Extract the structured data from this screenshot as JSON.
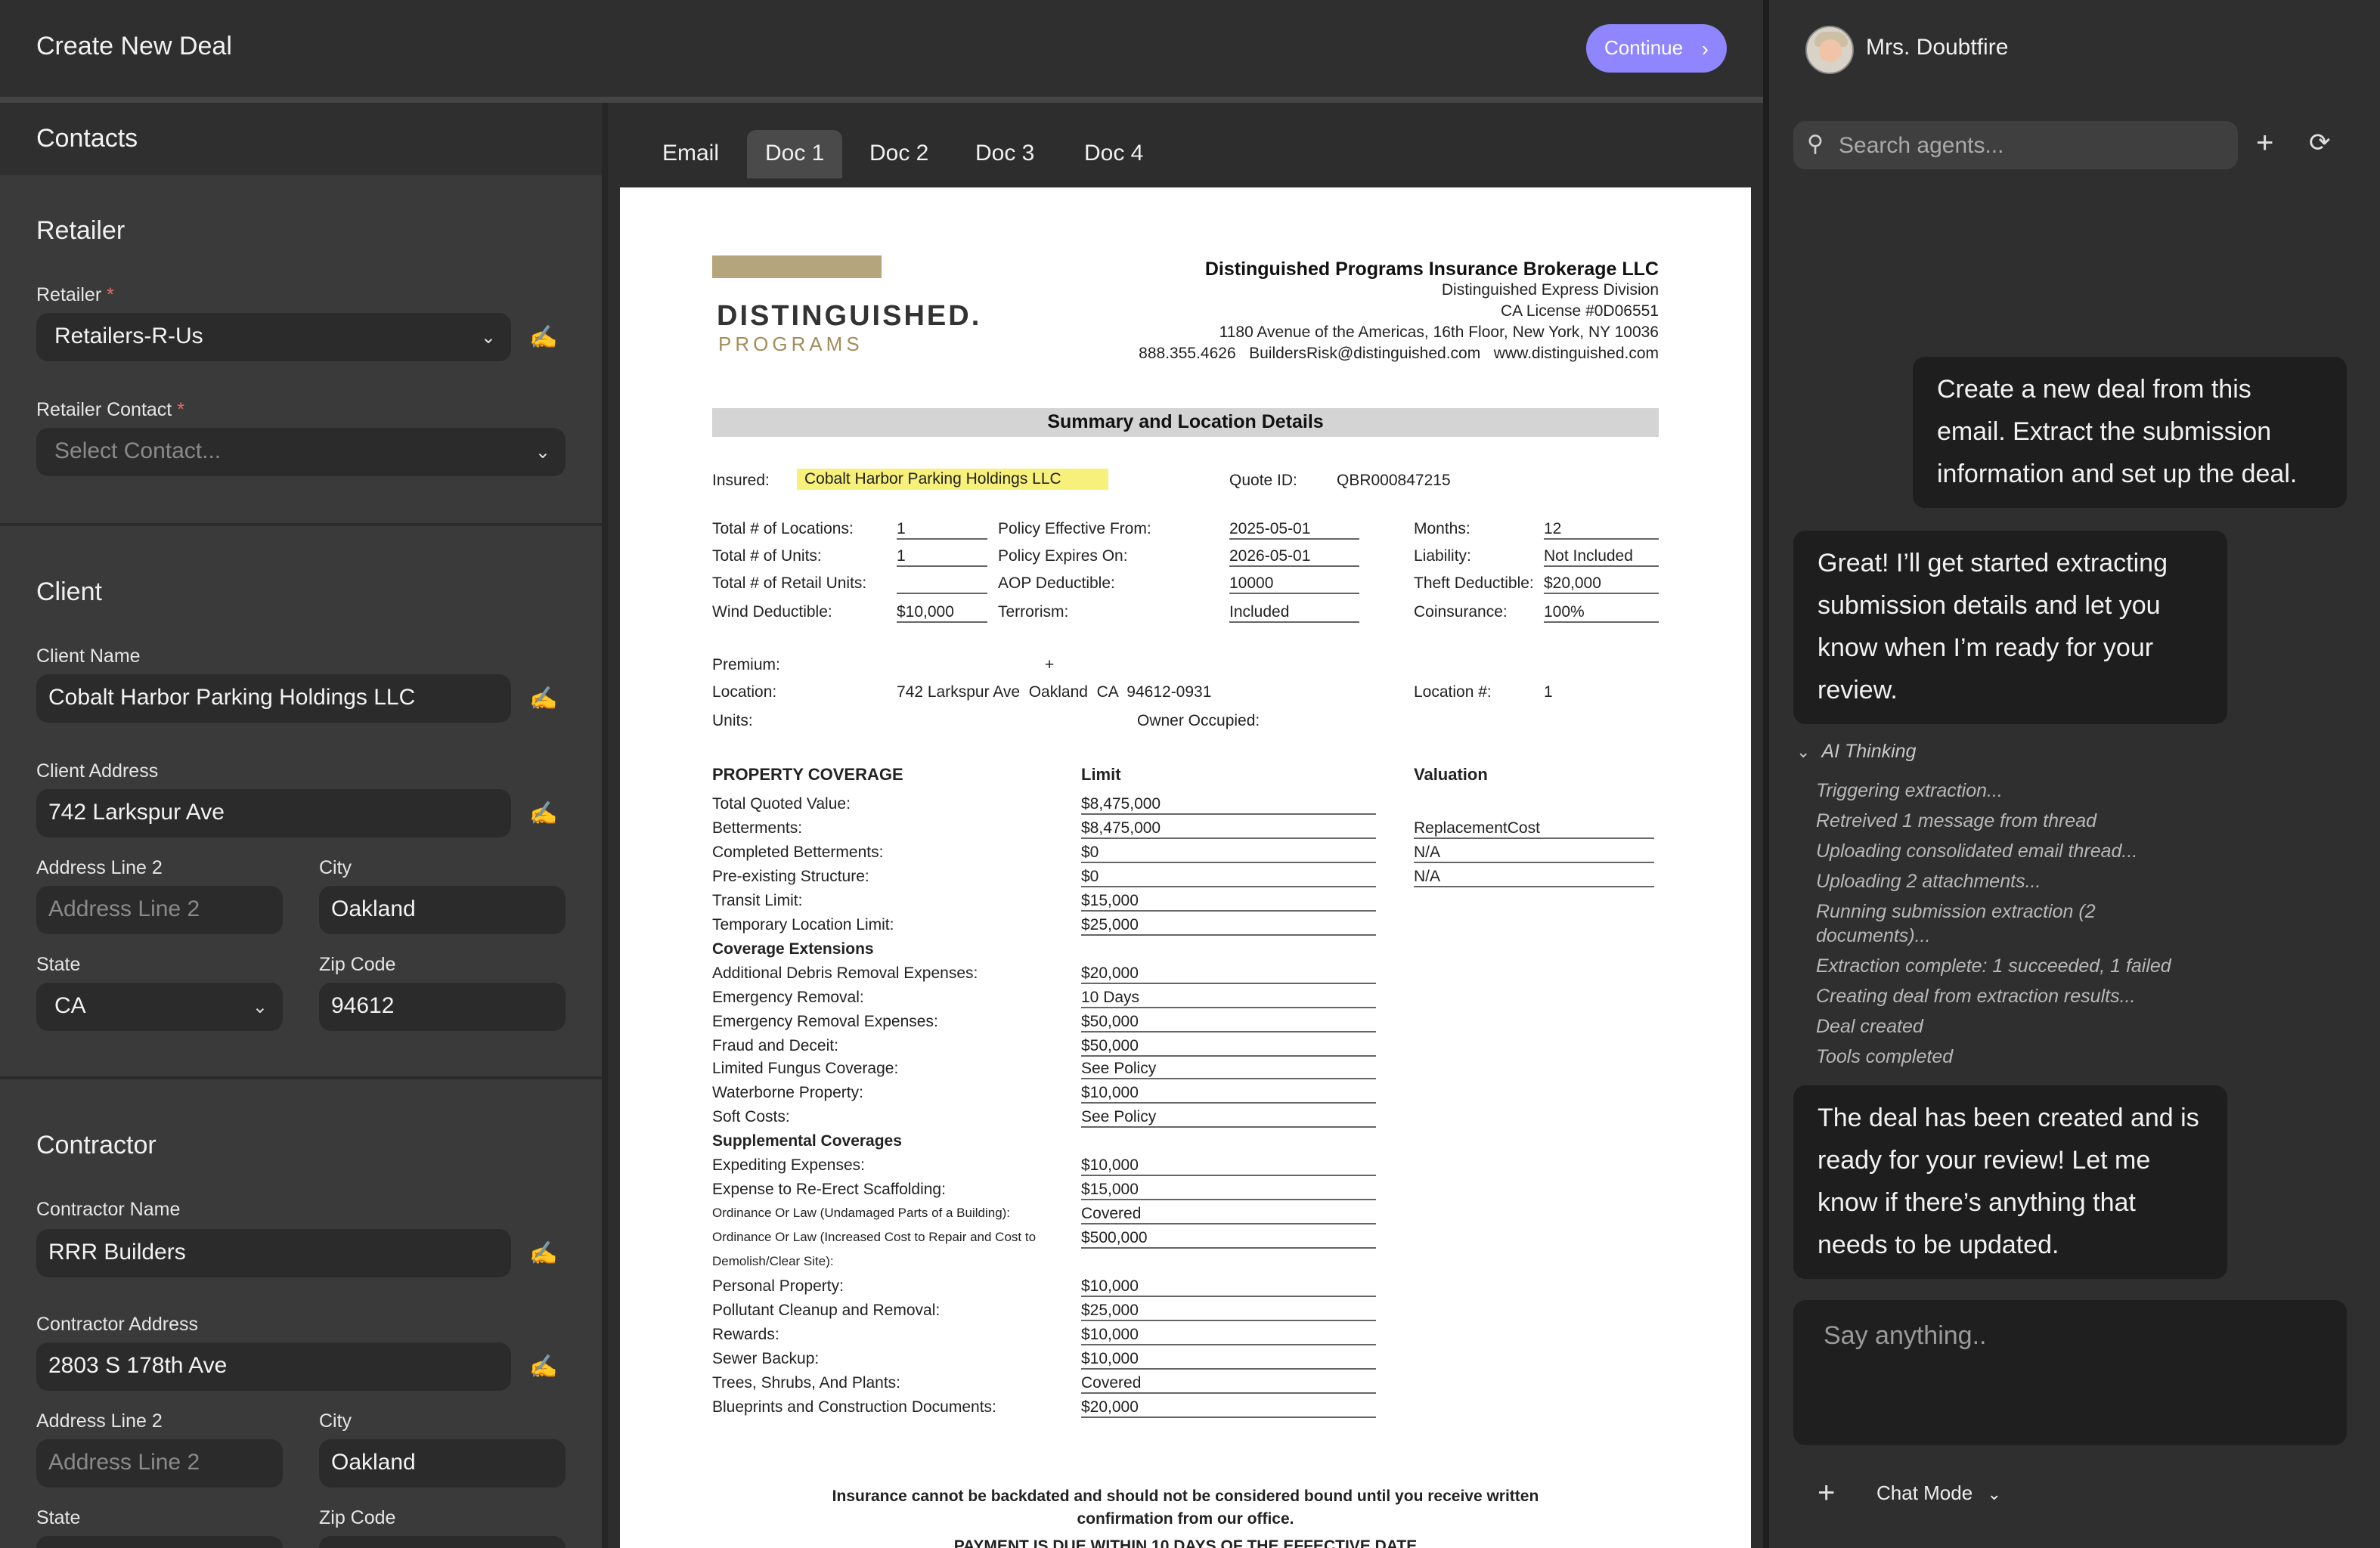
{
  "app": {
    "title": "Create New Deal",
    "continue_label": "Continue"
  },
  "tabs": [
    "Email",
    "Doc 1",
    "Doc 2",
    "Doc 3",
    "Doc 4"
  ],
  "contacts": {
    "title": "Contacts",
    "retailer": {
      "section": "Retailer",
      "retailer_label": "Retailer",
      "retailer_value": "Retailers-R-Us",
      "contact_label": "Retailer Contact",
      "contact_placeholder": "Select Contact..."
    },
    "client": {
      "section": "Client",
      "name_label": "Client Name",
      "name_value": "Cobalt Harbor Parking Holdings LLC",
      "address_label": "Client Address",
      "address_value": "742 Larkspur Ave",
      "addr2_label": "Address Line 2",
      "addr2_placeholder": "Address Line 2",
      "city_label": "City",
      "city_value": "Oakland",
      "state_label": "State",
      "state_value": "CA",
      "zip_label": "Zip Code",
      "zip_value": "94612"
    },
    "contractor": {
      "section": "Contractor",
      "name_label": "Contractor Name",
      "name_value": "RRR Builders",
      "address_label": "Contractor Address",
      "address_value": "2803 S 178th Ave",
      "addr2_label": "Address Line 2",
      "addr2_placeholder": "Address Line 2",
      "city_label": "City",
      "city_value": "Oakland",
      "state_label": "State",
      "zip_label": "Zip Code"
    }
  },
  "doc": {
    "logo_main": "DISTINGUISHED.",
    "logo_sub": "PROGRAMS",
    "company": "Distinguished Programs Insurance Brokerage LLC",
    "division": "Distinguished Express Division",
    "license": "CA License #0D06551",
    "address": "1180 Avenue of the Americas, 16th Floor, New York, NY 10036",
    "contact": "888.355.4626   BuildersRisk@distinguished.com   www.distinguished.com",
    "summary_title": "Summary and Location Details",
    "insured_label": "Insured:",
    "insured_value": "Cobalt Harbor Parking Holdings LLC",
    "quote_label": "Quote ID:",
    "quote_value": "QBR000847215",
    "col1": [
      {
        "label": "Total # of Locations:",
        "value": "1"
      },
      {
        "label": "Total # of Units:",
        "value": "1"
      },
      {
        "label": "Total # of Retail Units:",
        "value": ""
      },
      {
        "label": "Wind Deductible:",
        "value": "$10,000"
      }
    ],
    "col2": [
      {
        "label": "Policy Effective From:",
        "value": "2025-05-01"
      },
      {
        "label": "Policy Expires On:",
        "value": "2026-05-01"
      },
      {
        "label": "AOP Deductible:",
        "value": "10000"
      },
      {
        "label": "Terrorism:",
        "value": "Included"
      }
    ],
    "col3": [
      {
        "label": "Months:",
        "value": "12"
      },
      {
        "label": "Liability:",
        "value": "Not Included"
      },
      {
        "label": "Theft Deductible:",
        "value": "$20,000"
      },
      {
        "label": "Coinsurance:",
        "value": "100%"
      }
    ],
    "premium_label": "Premium:",
    "premium_plus": "+",
    "location_label": "Location:",
    "location_value": "742 Larkspur Ave  Oakland  CA  94612-0931",
    "location_num_label": "Location #:",
    "location_num_value": "1",
    "units_label": "Units:",
    "owner_label": "Owner Occupied:",
    "coverage_header": "PROPERTY COVERAGE",
    "limit_header": "Limit",
    "valuation_header": "Valuation",
    "coverage_rows": [
      {
        "label": "Total Quoted Value:",
        "limit": "$8,475,000",
        "style": ""
      },
      {
        "label": "Betterments:",
        "limit": "$8,475,000",
        "style": ""
      },
      {
        "label": "Completed Betterments:",
        "limit": "$0",
        "style": ""
      },
      {
        "label": "Pre-existing Structure:",
        "limit": "$0",
        "style": ""
      },
      {
        "label": "Transit Limit:",
        "limit": "$15,000",
        "style": ""
      },
      {
        "label": "Temporary Location Limit:",
        "limit": "$25,000",
        "style": ""
      },
      {
        "label": "Coverage Extensions",
        "limit": "",
        "style": "bold"
      },
      {
        "label": "Additional Debris Removal Expenses:",
        "limit": "$20,000",
        "style": ""
      },
      {
        "label": "Emergency Removal:",
        "limit": "10 Days",
        "style": ""
      },
      {
        "label": "Emergency Removal Expenses:",
        "limit": "$50,000",
        "style": ""
      },
      {
        "label": "Fraud and Deceit:",
        "limit": "$50,000",
        "style": ""
      },
      {
        "label": "Limited Fungus Coverage:",
        "limit": "See Policy",
        "style": ""
      },
      {
        "label": "Waterborne Property:",
        "limit": "$10,000",
        "style": ""
      },
      {
        "label": "Soft Costs:",
        "limit": "See Policy",
        "style": ""
      },
      {
        "label": "Supplemental Coverages",
        "limit": "",
        "style": "bold"
      },
      {
        "label": "Expediting Expenses:",
        "limit": "$10,000",
        "style": ""
      },
      {
        "label": "Expense to Re-Erect Scaffolding:",
        "limit": "$15,000",
        "style": ""
      },
      {
        "label": "Ordinance Or Law (Undamaged Parts of a Building):",
        "limit": "Covered",
        "style": "small"
      },
      {
        "label": "Ordinance Or Law (Increased Cost to Repair and Cost to",
        "limit": "$500,000",
        "style": "small"
      },
      {
        "label": "Demolish/Clear Site):",
        "limit": "",
        "style": "small"
      },
      {
        "label": "Personal Property:",
        "limit": "$10,000",
        "style": ""
      },
      {
        "label": "Pollutant Cleanup and Removal:",
        "limit": "$25,000",
        "style": ""
      },
      {
        "label": "Rewards:",
        "limit": "$10,000",
        "style": ""
      },
      {
        "label": "Sewer Backup:",
        "limit": "$10,000",
        "style": ""
      },
      {
        "label": "Trees, Shrubs, And Plants:",
        "limit": "Covered",
        "style": ""
      },
      {
        "label": "Blueprints and Construction Documents:",
        "limit": "$20,000",
        "style": ""
      }
    ],
    "valuation_values": [
      "ReplacementCost",
      "N/A",
      "N/A"
    ],
    "footer_line1": "Insurance cannot be backdated and should not be considered bound until you receive written",
    "footer_line2": "confirmation from our office.",
    "footer_line3": "PAYMENT IS DUE WITHIN 10 DAYS OF THE EFFECTIVE DATE"
  },
  "chat": {
    "user_name": "Mrs. Doubtfire",
    "search_placeholder": "Search agents...",
    "messages": [
      {
        "role": "user",
        "text": "Create a new deal from this email. Extract the submission information and set up the deal."
      },
      {
        "role": "assistant",
        "text": "Great! I’ll get started extracting submission details and let you know when I’m ready for your review."
      },
      {
        "role": "assistant",
        "text": "The deal has been created and is ready for your review! Let me know if there’s anything that needs to be updated."
      }
    ],
    "thinking_label": "AI Thinking",
    "thinking_steps": [
      "Triggering extraction...",
      "Retreived 1 message from thread",
      "Uploading consolidated email thread...",
      "Uploading 2 attachments...",
      "Running submission extraction (2 documents)...",
      "Extraction complete: 1 succeeded, 1 failed",
      "Creating deal from extraction results...",
      "Deal created",
      "Tools completed"
    ],
    "composer_placeholder": "Say anything..",
    "mode_label": "Chat Mode"
  },
  "colors": {
    "accent": "#8f85ff",
    "highlight": "#f7f07a",
    "logo_bar": "#b5a57c"
  },
  "icons": [
    "chevron-right-icon",
    "chevron-down-icon",
    "pen-icon",
    "search-icon",
    "plus-icon",
    "history-icon"
  ]
}
